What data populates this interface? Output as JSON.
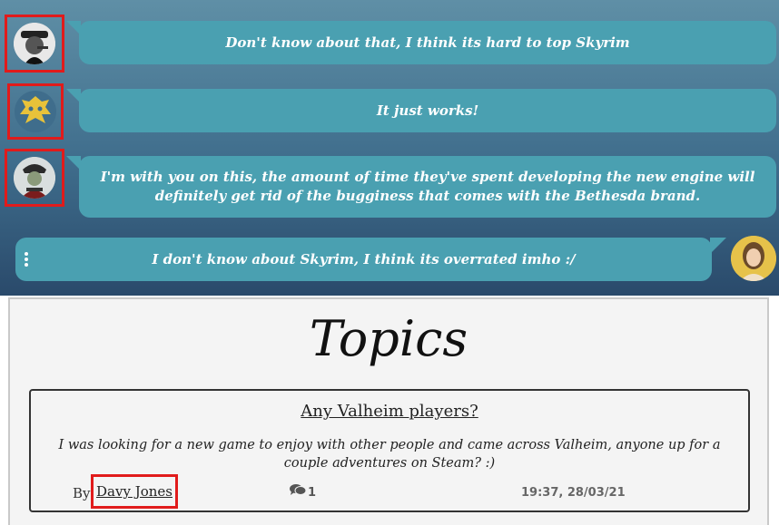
{
  "chat": {
    "messages": [
      {
        "text": "Don't know about that, I think its hard to top Skyrim",
        "avatar": "old-man-avatar-icon"
      },
      {
        "text": "It just works!",
        "avatar": "yellow-emblem-avatar-icon"
      },
      {
        "text": "I'm with you on this, the amount of time they've spent developing the new engine will definitely get rid of the bugginess that comes with the Bethesda brand.",
        "avatar": "pirate-avatar-icon"
      },
      {
        "text": "I don't know about Skyrim, I think its overrated imho :/",
        "avatar": "woman-avatar-icon"
      }
    ]
  },
  "topics": {
    "title": "Topics",
    "items": [
      {
        "heading": "Any Valheim players?",
        "body": "I was looking for a new game to enjoy with other people and came across Valheim, anyone up for a couple adventures on Steam? :)",
        "by_label": "By",
        "author": "Davy Jones",
        "replies": "1",
        "timestamp": "19:37, 28/03/21"
      }
    ]
  },
  "colors": {
    "bubble": "#4aa0b1",
    "highlight": "#e11b1b",
    "panel_bg": "#f4f4f4"
  }
}
